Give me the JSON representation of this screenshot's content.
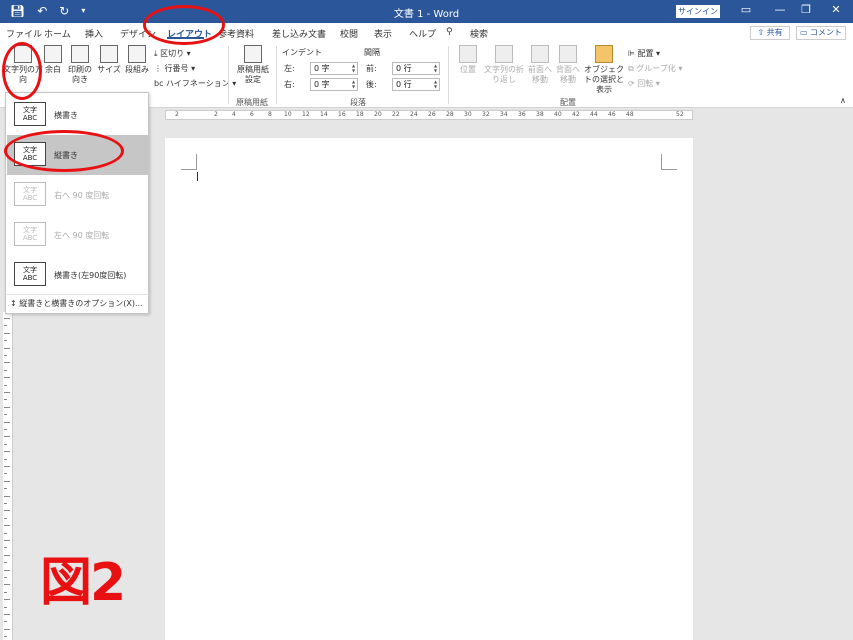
{
  "window": {
    "title": "文書 1 - Word",
    "signin": "サインイン",
    "qat": {
      "save_icon": "save-icon",
      "undo_icon": "undo-icon",
      "redo_icon": "redo-icon",
      "customize_icon": "customize-icon"
    }
  },
  "tabs": [
    "ファイル",
    "ホーム",
    "挿入",
    "デザイン",
    "レイアウト",
    "参考資料",
    "差し込み文書",
    "校閲",
    "表示",
    "ヘルプ",
    "検索"
  ],
  "active_tab": "レイアウト",
  "share_label": "共有",
  "comment_label": "コメント",
  "ribbon": {
    "page_setup": {
      "text_direction": "文字列の方向",
      "margins": "余白",
      "orientation": "印刷の向き",
      "size": "サイズ",
      "columns": "段組み",
      "breaks": "区切り",
      "line_numbers": "行番号",
      "hyphenation": "ハイフネーション"
    },
    "manuscript": {
      "button": "原稿用紙設定",
      "group": "原稿用紙"
    },
    "paragraph": {
      "indent_header": "インデント",
      "spacing_header": "間隔",
      "left_label": "左:",
      "right_label": "右:",
      "before_label": "前:",
      "after_label": "後:",
      "left_value": "0 字",
      "right_value": "0 字",
      "before_value": "0 行",
      "after_value": "0 行",
      "group": "段落"
    },
    "arrange": {
      "position": "位置",
      "wrap_text": "文字列の折り返し",
      "bring_forward": "前面へ移動",
      "send_backward": "背面へ移動",
      "selection_pane": "オブジェクトの選択と表示",
      "align": "配置",
      "group_btn": "グループ化",
      "rotate": "回転",
      "group": "配置"
    }
  },
  "ruler_ticks": [
    "2",
    "2",
    "4",
    "6",
    "8",
    "10",
    "12",
    "14",
    "16",
    "18",
    "20",
    "22",
    "24",
    "26",
    "28",
    "30",
    "32",
    "34",
    "36",
    "38",
    "40",
    "42",
    "44",
    "46",
    "48",
    "52"
  ],
  "dropdown": {
    "items": [
      {
        "icon_text": "文字\nABC",
        "label": "横書き",
        "disabled": false,
        "selected": false
      },
      {
        "icon_text": "文字\n縦",
        "label": "縦書き",
        "disabled": false,
        "selected": true
      },
      {
        "icon_text": "文字\nABC",
        "label": "右へ 90 度回転",
        "disabled": true,
        "selected": false
      },
      {
        "icon_text": "文字\nABC",
        "label": "左へ 90 度回転",
        "disabled": true,
        "selected": false
      },
      {
        "icon_text": "文字\nABC",
        "label": "横書き(左90度回転)",
        "disabled": false,
        "selected": false
      }
    ],
    "options_label": "縦書きと横書きのオプション(X)..."
  },
  "annotation": {
    "figure_label": "図2",
    "color": "#e81010"
  },
  "colors": {
    "titlebar": "#2b579a",
    "accent": "#2b579a"
  }
}
